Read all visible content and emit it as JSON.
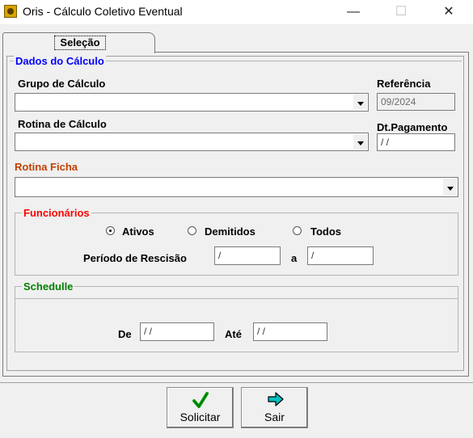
{
  "window": {
    "title": "Oris - Cálculo Coletivo Eventual",
    "minimize": "—",
    "maximize": "☐",
    "close": "✕"
  },
  "tab": {
    "label": "Seleção"
  },
  "dados": {
    "legend": "Dados do Cálculo",
    "grupo_label": "Grupo de Cálculo",
    "grupo_value": "",
    "referencia_label": "Referência",
    "referencia_value": "09/2024",
    "rotina_label": "Rotina de Cálculo",
    "rotina_value": "",
    "dtpag_label": "Dt.Pagamento",
    "dtpag_value": " / /",
    "ficha_label": "Rotina Ficha",
    "ficha_value": ""
  },
  "funcionarios": {
    "legend": "Funcionários",
    "options": [
      "Ativos",
      "Demitidos",
      "Todos"
    ],
    "selected": "Ativos",
    "periodo_label": "Período de Rescisão",
    "periodo_de": "/",
    "a_label": "a",
    "periodo_ate": "/"
  },
  "schedulle": {
    "legend": "Schedulle",
    "de_label": "De",
    "de_value": "/ /",
    "ate_label": "Até",
    "ate_value": "/ /"
  },
  "buttons": {
    "solicitar": "Solicitar",
    "sair": "Sair"
  },
  "colors": {
    "legend_blue": "#0000ff",
    "ficha_label": "#c04000",
    "funcionarios_red": "#ff0000",
    "schedulle_green": "#008000",
    "check_green": "#00a000",
    "arrow_cyan": "#00c0c0"
  }
}
